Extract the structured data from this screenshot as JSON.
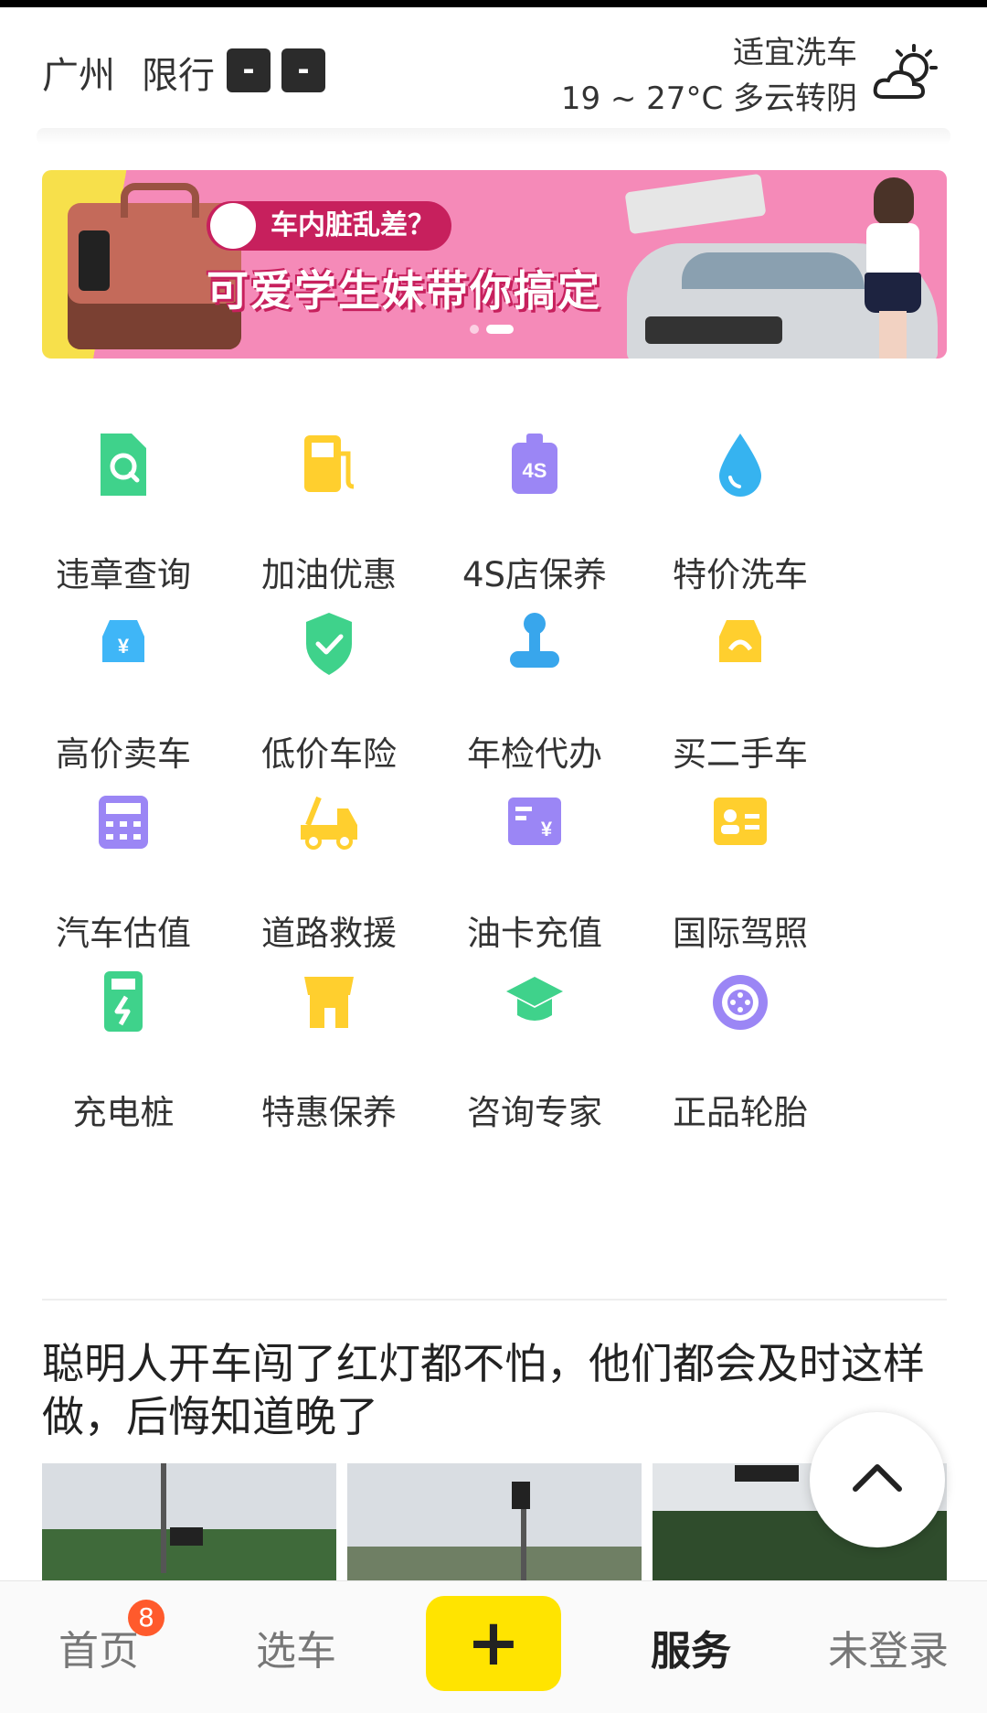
{
  "header": {
    "city": "广州",
    "limit_label": "限行",
    "plates": [
      "-",
      "-"
    ],
    "wash_advice": "适宜洗车",
    "temperature": "19 ~ 27°C 多云转阴",
    "weather_icon": "partly-cloudy-icon"
  },
  "banner": {
    "tag_text": "车内脏乱差？",
    "headline": "可爱学生妹带你搞定",
    "dots_count": 2,
    "active_dot": 1
  },
  "services": [
    {
      "label": "违章查询",
      "icon": "violation-query-icon",
      "color": "#3fd28b"
    },
    {
      "label": "加油优惠",
      "icon": "fuel-pump-icon",
      "color": "#ffcf2e"
    },
    {
      "label": "4S店保养",
      "icon": "4s-oil-icon",
      "color": "#9b86f5"
    },
    {
      "label": "特价洗车",
      "icon": "water-drop-icon",
      "color": "#36b3f0"
    },
    {
      "label": "高价卖车",
      "icon": "car-yuan-icon",
      "color": "#3fb6f7"
    },
    {
      "label": "低价车险",
      "icon": "shield-check-icon",
      "color": "#3fd28b"
    },
    {
      "label": "年检代办",
      "icon": "stamp-icon",
      "color": "#38a6ec"
    },
    {
      "label": "买二手车",
      "icon": "used-car-icon",
      "color": "#ffcf2e"
    },
    {
      "label": "汽车估值",
      "icon": "calculator-icon",
      "color": "#9b86f5"
    },
    {
      "label": "道路救援",
      "icon": "tow-truck-icon",
      "color": "#ffcf2e"
    },
    {
      "label": "油卡充值",
      "icon": "card-yuan-icon",
      "color": "#9b86f5"
    },
    {
      "label": "国际驾照",
      "icon": "license-card-icon",
      "color": "#ffcf2e"
    },
    {
      "label": "充电桩",
      "icon": "charging-pile-icon",
      "color": "#3fd28b"
    },
    {
      "label": "特惠保养",
      "icon": "shop-icon",
      "color": "#ffcf2e"
    },
    {
      "label": "咨询专家",
      "icon": "graduation-cap-icon",
      "color": "#3fd28b"
    },
    {
      "label": "正品轮胎",
      "icon": "tire-icon",
      "color": "#9b86f5"
    }
  ],
  "article": {
    "title": "聪明人开车闯了红灯都不怕，他们都会及时这样做，后悔知道晚了"
  },
  "bottom_nav": {
    "home": "首页",
    "home_badge": "8",
    "select_car": "选车",
    "plus": "+",
    "service": "服务",
    "login": "未登录"
  },
  "colors": {
    "accent_yellow": "#ffe400",
    "badge_orange": "#ff5a2c"
  }
}
